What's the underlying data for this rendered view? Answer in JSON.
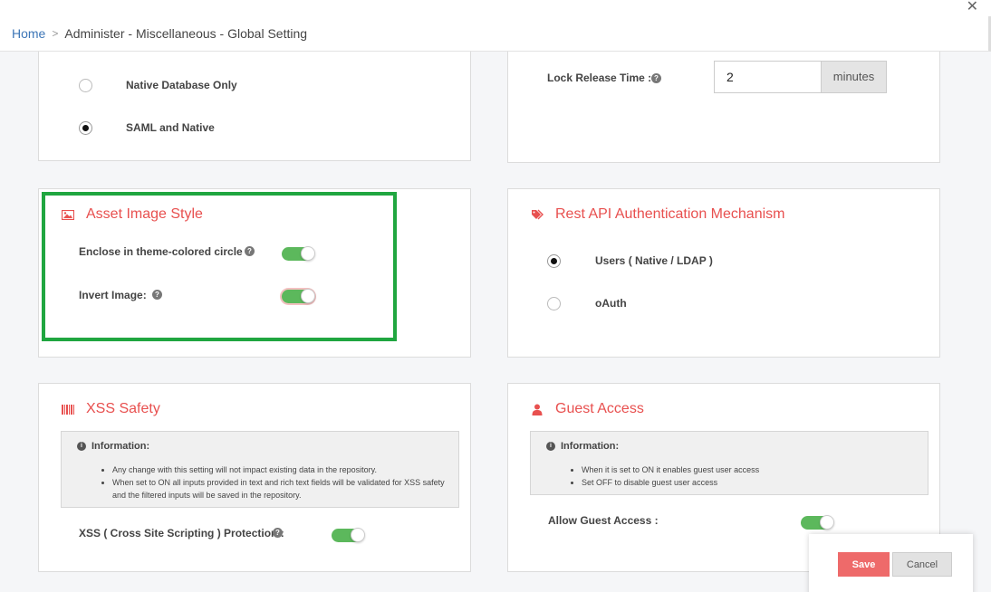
{
  "breadcrumb": {
    "home": "Home",
    "current": "Administer - Miscellaneous - Global Setting"
  },
  "auth_mode": {
    "options": [
      {
        "label": "Native Database Only",
        "checked": false
      },
      {
        "label": "SAML and Native",
        "checked": true
      }
    ]
  },
  "lock_release": {
    "label": "Lock Release Time :",
    "value": "2",
    "unit": "minutes"
  },
  "asset_image_style": {
    "title": "Asset Image Style",
    "icon": "image-icon",
    "enclose_label": "Enclose in theme-colored circle :",
    "enclose_on": true,
    "invert_label": "Invert Image:",
    "invert_on": true
  },
  "rest_api": {
    "title": "Rest API Authentication Mechanism",
    "icon": "tags-icon",
    "options": [
      {
        "label": "Users ( Native / LDAP )",
        "checked": true
      },
      {
        "label": "oAuth",
        "checked": false
      }
    ]
  },
  "xss": {
    "title": "XSS Safety",
    "icon": "barcode-icon",
    "info_title": "Information:",
    "info_items": [
      "Any change with this setting will not impact existing data in the repository.",
      "When set to ON all inputs provided in text and rich text fields will be validated for XSS safety and the filtered inputs will be saved in the repository."
    ],
    "protection_label": "XSS ( Cross Site Scripting ) Protection :",
    "protection_on": true
  },
  "guest": {
    "title": "Guest Access",
    "icon": "user-icon",
    "info_title": "Information:",
    "info_items": [
      "When it is set to ON it enables guest user access",
      "Set OFF to disable guest user access"
    ],
    "allow_label": "Allow Guest Access :",
    "allow_on": true
  },
  "actions": {
    "save": "Save",
    "cancel": "Cancel"
  },
  "colors": {
    "accent_red": "#e8504f",
    "toggle_green": "#5cb85c",
    "highlight_green": "#20a640",
    "link_blue": "#3d76b7"
  }
}
